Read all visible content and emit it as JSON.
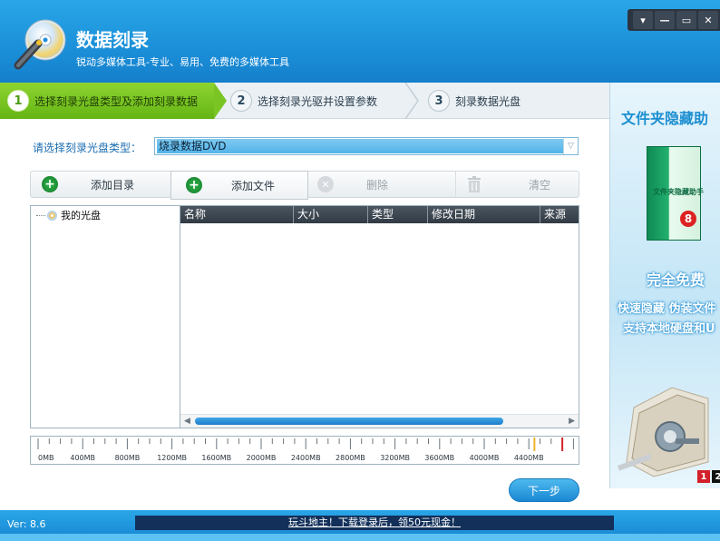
{
  "header": {
    "title": "数据刻录",
    "subtitle": "锐动多媒体工具-专业、易用、免费的多媒体工具",
    "window_controls": [
      "▾",
      "—",
      "▭",
      "✕"
    ]
  },
  "steps": [
    {
      "num": "1",
      "label": "选择刻录光盘类型及添加刻录数据",
      "active": true
    },
    {
      "num": "2",
      "label": "选择刻录光驱并设置参数",
      "active": false
    },
    {
      "num": "3",
      "label": "刻录数据光盘",
      "active": false
    }
  ],
  "disc_type": {
    "label": "请选择刻录光盘类型：",
    "value": "烧录数据DVD"
  },
  "toolbar": {
    "add_dir": "添加目录",
    "add_file": "添加文件",
    "delete": "删除",
    "clear": "清空"
  },
  "tree": {
    "root": "我的光盘"
  },
  "file_list": {
    "columns": [
      "名称",
      "大小",
      "类型",
      "修改日期",
      "来源"
    ]
  },
  "capacity_ruler": {
    "labels": [
      "0MB",
      "400MB",
      "800MB",
      "1200MB",
      "1600MB",
      "2000MB",
      "2400MB",
      "2800MB",
      "3200MB",
      "3600MB",
      "4000MB",
      "4400MB"
    ],
    "marker_mb": 4700,
    "soft_marker_mb": 4450
  },
  "next_button": "下一步",
  "ad": {
    "title": "文件夹隐藏助",
    "box_text": "文件夹隐藏助手",
    "box_badge": "8",
    "free": "完全免费",
    "line1": "快速隐藏 伪装文件",
    "line2": "支持本地硬盘和U",
    "num1": "1",
    "num2": "2"
  },
  "footer": {
    "version": "Ver: 8.6",
    "promo": "玩斗地主！下载登录后，领50元现金！"
  },
  "colors": {
    "header_blue": "#1b8fd8",
    "step_active_green": "#7ac524",
    "link_blue": "#1c6db0",
    "promo_bg": "#12305a"
  }
}
